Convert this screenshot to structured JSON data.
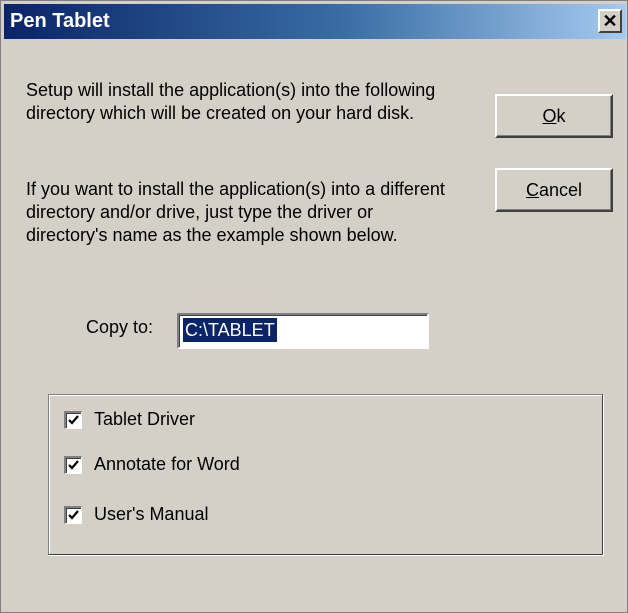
{
  "window": {
    "title": "Pen Tablet",
    "close_icon": "close-icon"
  },
  "message": {
    "paragraph1": "Setup will install the application(s) into the following directory which will be created on your hard disk.",
    "paragraph2": "If you want to install the application(s) into a different directory and/or drive, just type the driver or directory's name as the example shown below."
  },
  "buttons": {
    "ok": {
      "label_mnemonic": "O",
      "label_rest": "k"
    },
    "cancel": {
      "label_mnemonic": "C",
      "label_rest": "ancel"
    }
  },
  "copy_to": {
    "label": "Copy to:",
    "value": "C:\\TABLET"
  },
  "components": [
    {
      "label": "Tablet Driver",
      "checked": true
    },
    {
      "label": "Annotate for Word",
      "checked": true
    },
    {
      "label": "User's Manual",
      "checked": true
    }
  ],
  "colors": {
    "title_gradient_start": "#0a246a",
    "title_gradient_end": "#a6caf0",
    "dialog_background": "#d4d0c8",
    "selection_highlight": "#0a246a"
  }
}
